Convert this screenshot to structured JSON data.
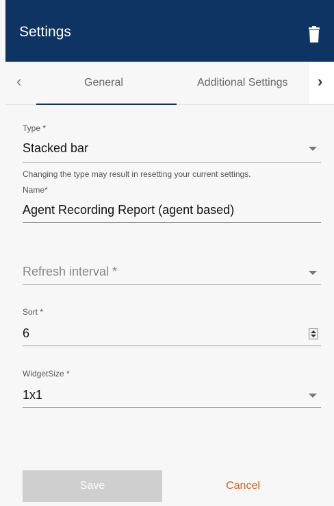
{
  "header": {
    "title": "Settings",
    "delete_icon": "trash-icon"
  },
  "tabs": [
    {
      "label": "General"
    },
    {
      "label": "Additional Settings"
    }
  ],
  "navigation": {
    "prev_icon": "chevron-left-icon",
    "next_icon": "chevron-right-icon"
  },
  "type_field": {
    "label": "Type *",
    "value": "Stacked bar",
    "hint": "Changing the type may result in resetting your current settings."
  },
  "name_field": {
    "label": "Name*",
    "value": "Agent Recording Report (agent based)"
  },
  "refresh_field": {
    "placeholder": "Refresh interval *"
  },
  "sort_field": {
    "label": "Sort *",
    "value": "6"
  },
  "widget_size_field": {
    "label": "WidgetSize *",
    "value": "1x1"
  },
  "actions": {
    "save_label": "Save",
    "cancel_label": "Cancel"
  },
  "colors": {
    "header_bg": "#0e3463",
    "accent_cancel": "#d95f1d",
    "save_disabled_bg": "#cfcfcf"
  }
}
